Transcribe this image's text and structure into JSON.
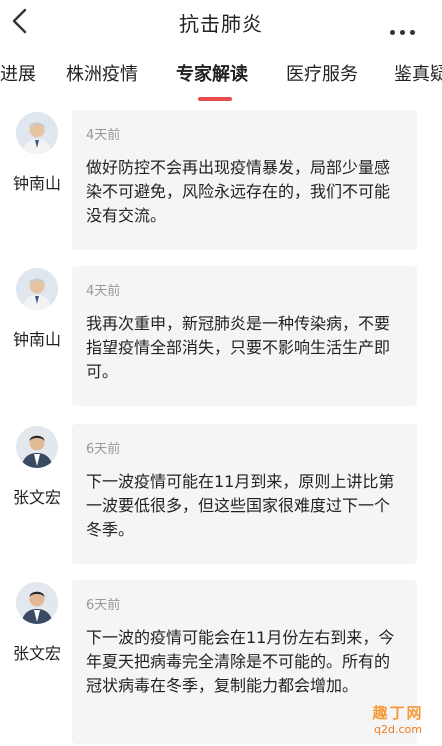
{
  "header": {
    "title": "抗击肺炎",
    "back_icon": "back-chevron-icon",
    "more_icon": "more-dots-icon"
  },
  "tabs": [
    {
      "label": "进展",
      "active": false
    },
    {
      "label": "株洲疫情",
      "active": false
    },
    {
      "label": "专家解读",
      "active": true
    },
    {
      "label": "医疗服务",
      "active": false
    },
    {
      "label": "鉴真疑",
      "active": false
    }
  ],
  "accent_color": "#e94d4d",
  "feed": [
    {
      "author": "钟南山",
      "time": "4天前",
      "text": "做好防控不会再出现疫情暴发，局部少量感染不可避免，风险永远存在的，我们不可能没有交流。"
    },
    {
      "author": "钟南山",
      "time": "4天前",
      "text": "我再次重申，新冠肺炎是一种传染病，不要指望疫情全部消失，只要不影响生活生产即可。"
    },
    {
      "author": "张文宏",
      "time": "6天前",
      "text": "下一波疫情可能在11月到来，原则上讲比第一波要低很多，但这些国家很难度过下一个冬季。"
    },
    {
      "author": "张文宏",
      "time": "6天前",
      "text": "下一波的疫情可能会在11月份左右到来，今年夏天把病毒完全清除是不可能的。所有的冠状病毒在冬季，复制能力都会增加。"
    }
  ],
  "watermark": {
    "top": "趣丁网",
    "bottom": "q2d.com"
  }
}
